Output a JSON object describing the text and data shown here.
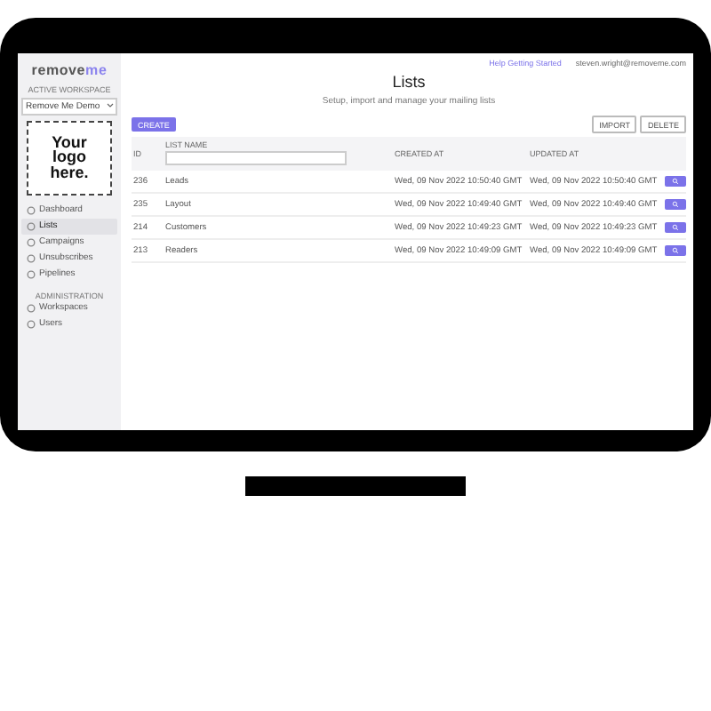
{
  "sidebar": {
    "brand": {
      "main": "remove",
      "accent": "me"
    },
    "workspace_label": "ACTIVE WORKSPACE",
    "workspace": "Remove Me Demo",
    "logo_text": "Your logo here.",
    "items": [
      {
        "label": "Dashboard",
        "selected": false
      },
      {
        "label": "Lists",
        "selected": true
      },
      {
        "label": "Campaigns",
        "selected": false
      },
      {
        "label": "Unsubscribes",
        "selected": false
      },
      {
        "label": "Pipelines",
        "selected": false
      }
    ],
    "admin_label": "ADMINISTRATION",
    "admin_items": [
      {
        "label": "Workspaces",
        "selected": false
      },
      {
        "label": "Users",
        "selected": false
      }
    ]
  },
  "topbar": {
    "help": "Help Getting Started",
    "user": "steven.wright@removeme.com"
  },
  "page": {
    "title": "Lists",
    "subtitle": "Setup, import and manage your mailing lists"
  },
  "toolbar": {
    "create": "CREATE",
    "actions": [
      "IMPORT",
      "DELETE"
    ]
  },
  "table": {
    "columns": [
      "ID",
      "LIST NAME",
      "CREATED AT",
      "UPDATED AT"
    ],
    "rows": [
      {
        "id": "236",
        "name": "Leads",
        "created": "Wed, 09 Nov 2022 10:50:40 GMT",
        "updated": "Wed, 09 Nov 2022 10:50:40 GMT"
      },
      {
        "id": "235",
        "name": "Layout",
        "created": "Wed, 09 Nov 2022 10:49:40 GMT",
        "updated": "Wed, 09 Nov 2022 10:49:40 GMT"
      },
      {
        "id": "214",
        "name": "Customers",
        "created": "Wed, 09 Nov 2022 10:49:23 GMT",
        "updated": "Wed, 09 Nov 2022 10:49:23 GMT"
      },
      {
        "id": "213",
        "name": "Readers",
        "created": "Wed, 09 Nov 2022 10:49:09 GMT",
        "updated": "Wed, 09 Nov 2022 10:49:09 GMT"
      }
    ]
  }
}
